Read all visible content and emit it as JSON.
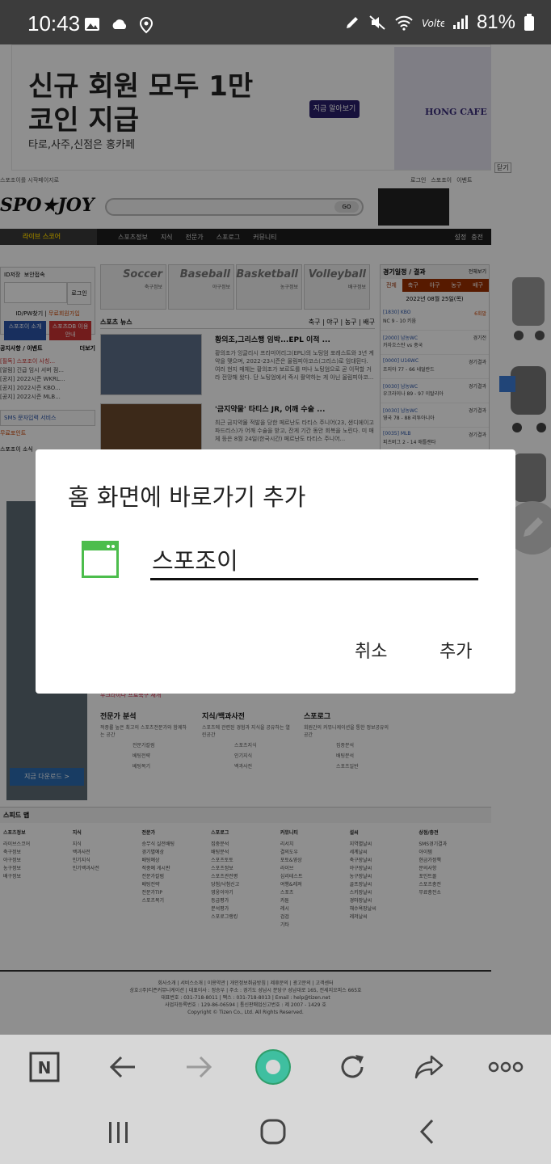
{
  "status_bar": {
    "time": "10:43",
    "battery": "81%",
    "icons": [
      "image-icon",
      "cloud-icon",
      "location-icon",
      "pen-icon",
      "mute-icon",
      "wifi-icon",
      "volte-icon",
      "signal-icon",
      "battery-icon"
    ]
  },
  "ad": {
    "headline": "신규 회원 모두 1만 코인 지급",
    "sub": "타로,사주,신점은 홍카페",
    "cta": "지금 알아보기",
    "brand": "HONG CAFE",
    "close": "닫기"
  },
  "site": {
    "top_text": "스포조이를 시작페이지로",
    "top_links": [
      "로그인",
      "스포조이",
      "이벤트"
    ],
    "logo": "SPO★JOY",
    "search_go": "GO",
    "nav_live": "라이브 스코어",
    "nav_items": [
      "스포츠정보",
      "지식",
      "전문가",
      "스포로그",
      "커뮤니티"
    ],
    "nav_right": [
      "설정",
      "충전"
    ],
    "left_col": {
      "id_save": "ID저장",
      "secure": "보안접속",
      "login": "로그인",
      "find": "ID/PW찾기",
      "join": "무료회원가입",
      "btn1": "스포조이 소개",
      "btn2": "스포츠DB 이용안내",
      "notice_title": "공지사항 / 이벤트",
      "notice_more": "더보기",
      "notices": [
        "[필독] 스포조이 사칭...",
        "[알림] 긴급 임시 서버 점...",
        "[공지] 2022시즌 WKRL...",
        "[공지] 2022시즌 KBO...",
        "[공지] 2022시즌 MLB..."
      ],
      "sms": "SMS 문자입력 서비스",
      "free": "무료포인트",
      "spojoy": "스포조이 소식"
    },
    "sports": [
      "Soccer",
      "Baseball",
      "Basketball",
      "Volleyball"
    ],
    "sports_kr": [
      "축구정보",
      "야구정보",
      "농구정보",
      "배구정보"
    ],
    "news_head": "스포츠 뉴스",
    "news_tabs": "축구 | 야구 | 농구 | 배구",
    "news": [
      {
        "title": "황의조,그리스행 임박...EPL 이적 ...",
        "body": "황의조가 잉글리시 프리미어리그(EPL)의 노팅엄 포레스트와 3년 계약을 맺으며, 2022-23시즌은 올림피아코스(그리스)로 임대된다. 여러 현지 매체는 황의조가 보르도를 떠나 노팅엄으로 곧 이적할 거라 전망해 왔다. 단 노팅엄에서 즉시 활약하는 게 아닌 올림피아코..."
      },
      {
        "title": "'금지약물' 타티스 JR, 어깨 수술 ...",
        "body": "최근 금지약물 적발을 당한 페르난도 타티스 주니어(23, 샌디에이고 파드리스)가 어깨 수술을 받고, 잔게 기간 동안 회복을 노린다. 미 매체 등은 8월 24일(한국시간) 페르난도 타티스 주니어..."
      }
    ],
    "right_col": {
      "title": "경기일정 / 결과",
      "more": "전체보기",
      "tabs": [
        "전체",
        "축구",
        "야구",
        "농구",
        "배구"
      ],
      "date": "2022년 08월 25일(목)",
      "rows": [
        {
          "code": "[1830] KBO",
          "status": "6회말",
          "teams": "NC 9 - 10 키움"
        },
        {
          "code": "[2000] 남농WC",
          "status": "경기전",
          "teams": "카자흐스탄 vs 중국"
        },
        {
          "code": "[0000] U16WC",
          "status": "경기결과",
          "teams": "조지아 77 - 66 네덜란드"
        },
        {
          "code": "[0030] 남농WC",
          "status": "경기결과",
          "teams": "우크라이나 89 - 97 이탈리아"
        },
        {
          "code": "[0030] 남농WC",
          "status": "경기결과",
          "teams": "영국 78 - 88 리투아니아"
        },
        {
          "code": "[0035] MLB",
          "status": "경기결과",
          "teams": "피츠버그 2 - 14 애틀랜타"
        }
      ]
    },
    "lower_ad_btn": "지금 다운로드 >",
    "lower_bar": "우크라이나 프로축구 재개",
    "lower_cols": [
      {
        "head": "전문가 분석",
        "desc": "적중률 높은 최고의 스포츠전문가와 함께하는 공간",
        "items": [
          "전문가칼럼",
          "베팅전략",
          "베팅복기"
        ]
      },
      {
        "head": "지식/백과사전",
        "desc": "스포츠에 관련된 경험과 지식을 공유하는 열린공간",
        "items": [
          "스포츠지식",
          "인기지식",
          "백과사전"
        ]
      },
      {
        "head": "스포로그",
        "desc": "회원간의 커뮤니케이션을 통한 정보공유의 공간",
        "items": [
          "집중분석",
          "배팅분석",
          "스포츠일반"
        ]
      }
    ],
    "sitemap_title": "스피드 맵",
    "sitemap": [
      {
        "head": "스포츠정보",
        "items": [
          "라이브스코어",
          "축구정보",
          "야구정보",
          "농구정보",
          "배구정보"
        ]
      },
      {
        "head": "지식",
        "items": [
          "지식",
          "백과사전",
          "인기지식",
          "인기백과사전"
        ]
      },
      {
        "head": "전문가",
        "items": [
          "승무식 실전배팅",
          "경기별예상",
          "배팅예상",
          "적중예 게시판",
          "전문가칼럼",
          "배팅전략",
          "전문가TIP",
          "스포츠복기"
        ]
      },
      {
        "head": "스포로그",
        "items": [
          "집중분석",
          "배팅분석",
          "스포츠토토",
          "스포츠정보",
          "스포츠관전평",
          "당첨/낙첨신고",
          "영웅이야기",
          "등급평가",
          "분석평가",
          "스포로그랭킹"
        ]
      },
      {
        "head": "커뮤니티",
        "items": [
          "리서치",
          "결의도우",
          "포토&영상",
          "라이브",
          "심리테스트",
          "여행&레져",
          "스포츠",
          "카툰",
          "레시",
          "검검",
          "기타"
        ]
      },
      {
        "head": "설씨",
        "items": [
          "지역별날씨",
          "세계날씨",
          "축구장날씨",
          "야구장날씨",
          "농구장날씨",
          "골프장날씨",
          "스키장날씨",
          "경마장날씨",
          "해수욕장날씨",
          "레저날씨"
        ]
      },
      {
        "head": "상점/충전",
        "items": [
          "SMS경기결과",
          "아이템",
          "현금가정책",
          "문의사항",
          "포인트몰",
          "스포츠충전",
          "무료충전소"
        ]
      }
    ],
    "footer": [
      "회사소개 | 서비스소개 | 이용약관 | 개인정보취급방침 | 제휴문의 | 광고문의 | 고객센터",
      "상호:(주)티즌커뮤니케이션 | 대표이사 : 정승우 | 주소 : 경기도 성남시 분당구 성남대로 165, 전세지오피스 665호",
      "대표번호 : 031-718-8011 | 팩스 : 031-718-8013 | Email : help@tizen.net",
      "사업자등록번호 : 129-86-06594 | 통신판매업신고번호 : 제 2007 - 1429 호",
      "Copyright © Tizen Co., Ltd. All Rights Reserved."
    ]
  },
  "dialog": {
    "title": "홈 화면에 바로가기 추가",
    "input_value": "스포조이",
    "cancel": "취소",
    "add": "추가"
  },
  "browser_toolbar": {
    "buttons": [
      "tabs-n-icon",
      "back-arrow-icon",
      "forward-arrow-icon",
      "home-icon",
      "refresh-icon",
      "share-icon",
      "more-icon"
    ],
    "tab_letter": "N"
  },
  "nav_bar": {
    "buttons": [
      "recent-apps-icon",
      "home-circle-icon",
      "back-chevron-icon"
    ]
  }
}
